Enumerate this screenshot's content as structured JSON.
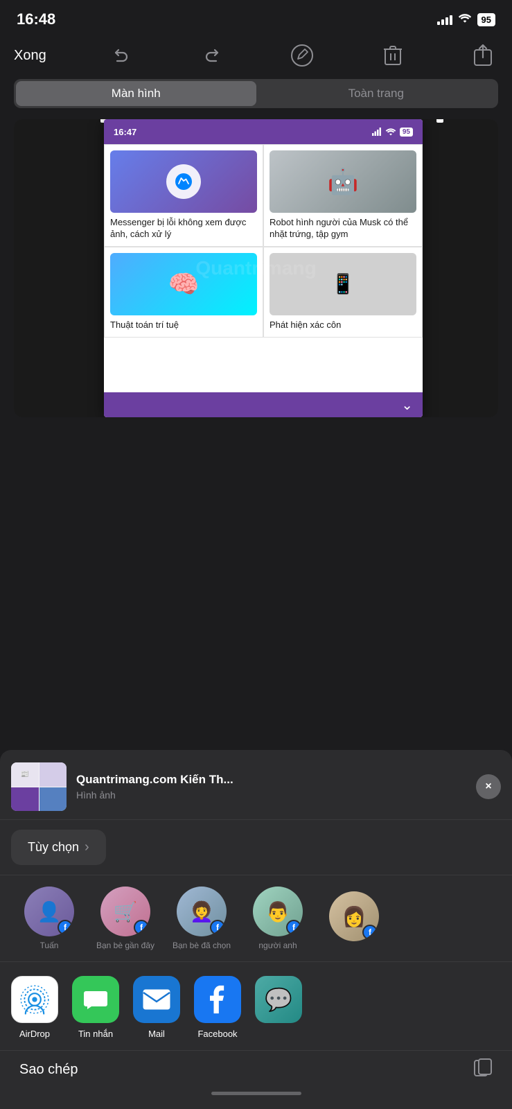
{
  "statusBar": {
    "time": "16:48",
    "battery": "95"
  },
  "toolbar": {
    "doneLabel": "Xong"
  },
  "segmentControl": {
    "option1": "Màn hình",
    "option2": "Toàn trang",
    "activeIndex": 0
  },
  "innerScreenshot": {
    "time": "16:47",
    "battery": "95",
    "articles": [
      {
        "title": "Messenger bị lỗi không xem được ảnh, cách xử lý"
      },
      {
        "title": "Robot hình người của Musk có thể nhặt trứng, tập gym"
      },
      {
        "title": "Thuật toán trí tuệ"
      },
      {
        "title": "Phát hiện xác côn"
      }
    ]
  },
  "shareSheet": {
    "title": "Quantrimang.com Kiến Th...",
    "subtitle": "Hình ảnh",
    "closeLabel": "×",
    "optionsLabel": "Tùy chọn",
    "optionsChevron": "›"
  },
  "contacts": [
    {
      "name": "Tuấn",
      "bgClass": "avatar-bg-1"
    },
    {
      "name": "Bạn bè gần đây",
      "bgClass": "avatar-bg-2"
    },
    {
      "name": "Bạn bè đã chọn",
      "bgClass": "avatar-bg-3"
    },
    {
      "name": "người anh",
      "bgClass": "avatar-bg-4"
    },
    {
      "name": "",
      "bgClass": "avatar-bg-5"
    }
  ],
  "apps": [
    {
      "name": "AirDrop",
      "type": "airdrop"
    },
    {
      "name": "Tin nhắn",
      "type": "messages"
    },
    {
      "name": "Mail",
      "type": "mail"
    },
    {
      "name": "Facebook",
      "type": "facebook"
    }
  ],
  "bottomBar": {
    "label": "Sao chép"
  },
  "watermark": "Quantrimang"
}
